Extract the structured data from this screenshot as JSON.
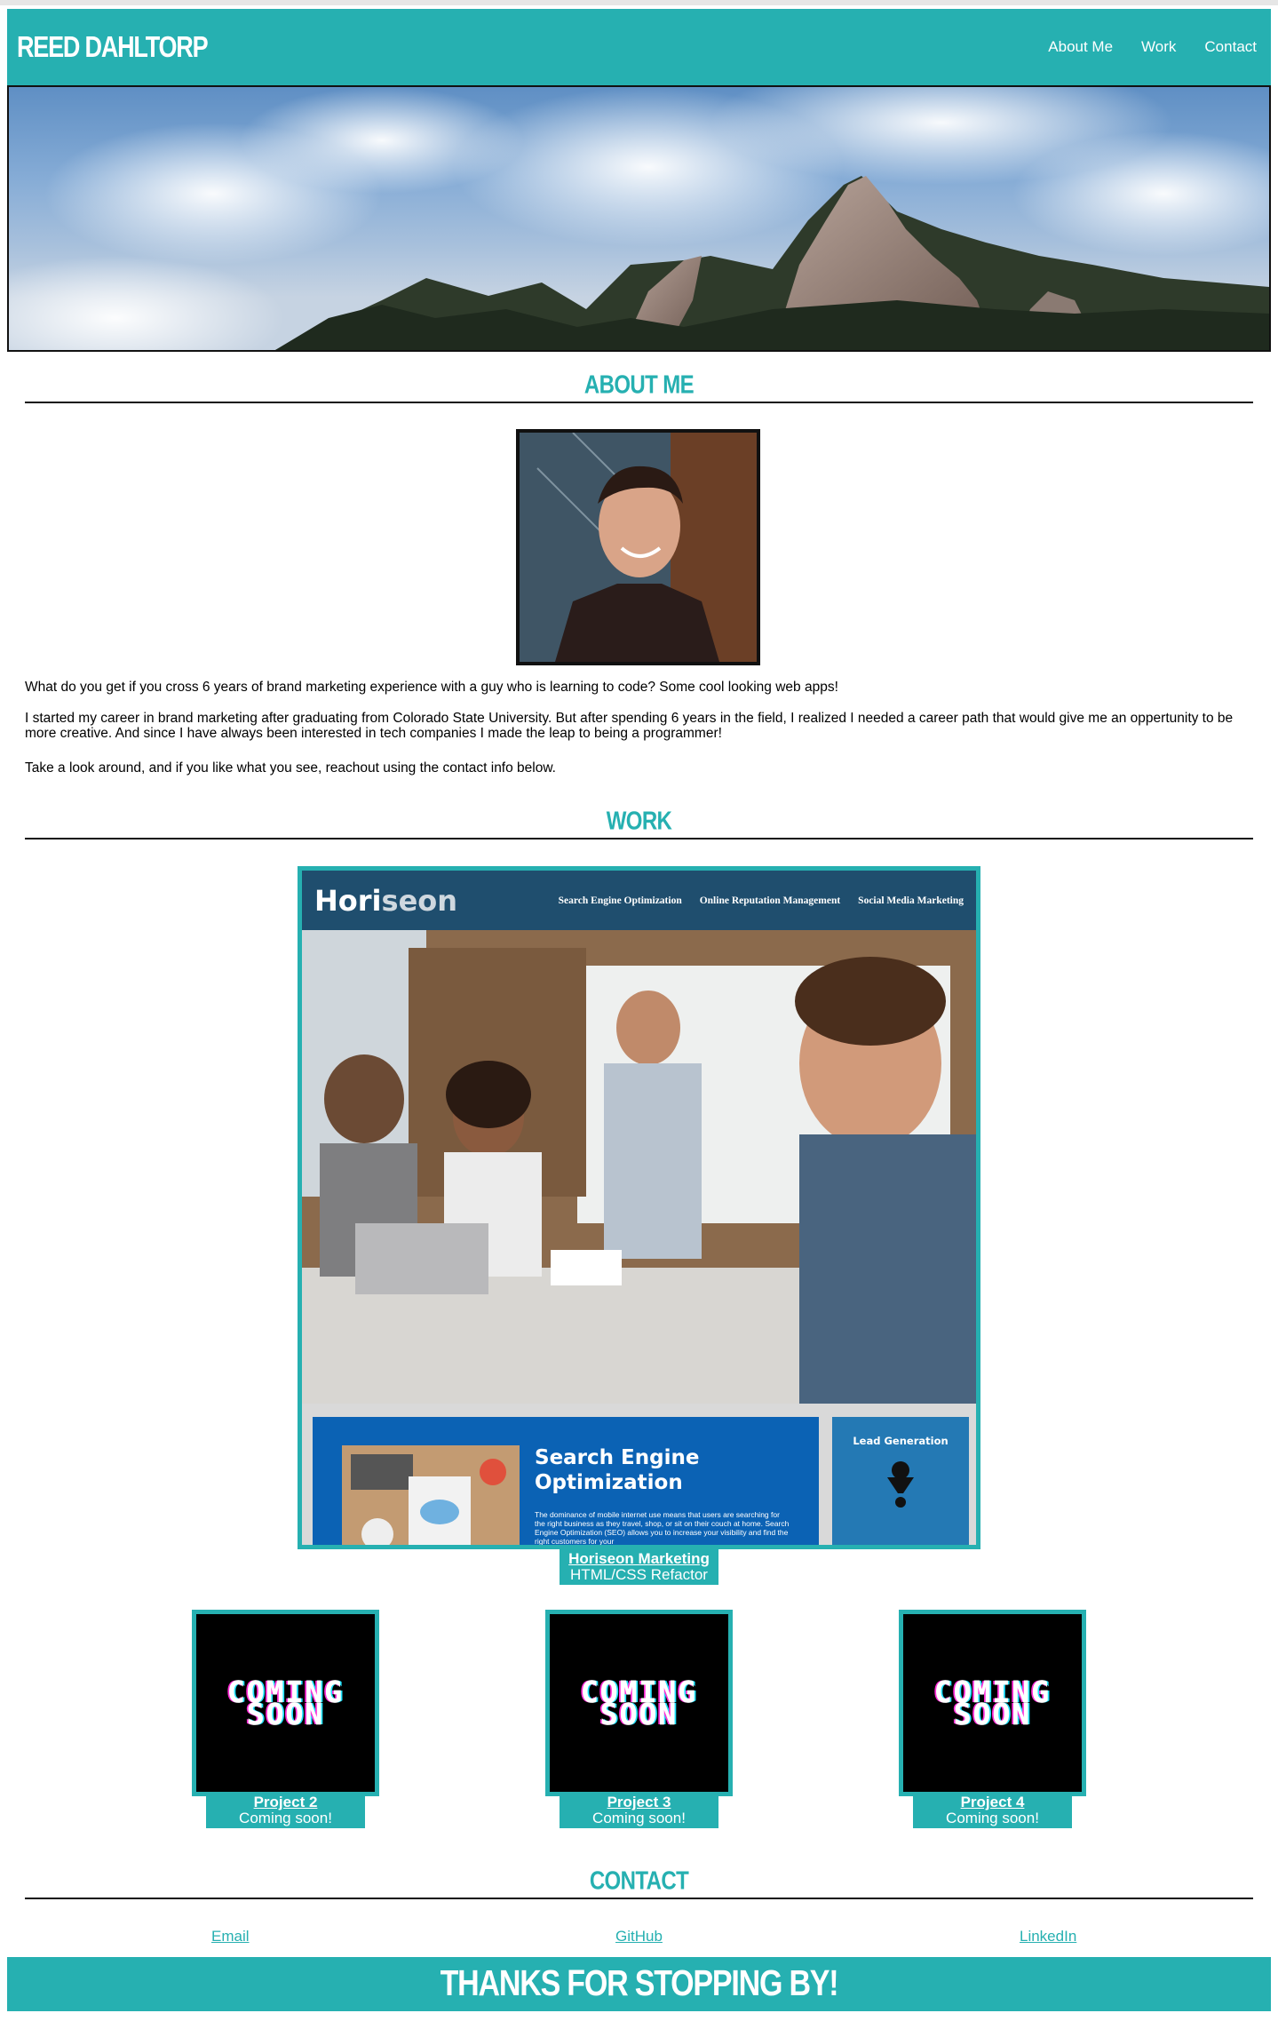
{
  "header": {
    "brand": "REED DAHLTORP",
    "nav": [
      {
        "label": "About Me"
      },
      {
        "label": "Work"
      },
      {
        "label": "Contact"
      }
    ]
  },
  "about": {
    "heading": "ABOUT ME",
    "paragraphs": [
      "What do you get if you cross 6 years of brand marketing experience with a guy who is learning to code? Some cool looking web apps!",
      "I started my career in brand marketing after graduating from Colorado State University. But after spending 6 years in the field, I realized I needed a career path that would give me an oppertunity to be more creative. And since I have always been interested in tech companies I made the leap to being a programmer!",
      "Take a look around, and if you like what you see, reachout using the contact info below."
    ]
  },
  "work": {
    "heading": "WORK",
    "featured": {
      "title": "Horiseon Marketing",
      "subtitle": "HTML/CSS Refactor",
      "screenshot": {
        "logo_main": "Hori",
        "logo_alt": "seon",
        "nav": [
          "Search Engine Optimization",
          "Online Reputation Management",
          "Social Media Marketing"
        ],
        "panel_title": "Search Engine Optimization",
        "panel_text": "The dominance of mobile internet use means that users are searching for the right business as they travel, shop, or sit on their couch at home. Search Engine Optimization (SEO) allows you to increase your visibility and find the right customers for your",
        "side_title": "Lead Generation"
      }
    },
    "projects": [
      {
        "title": "Project 2",
        "subtitle": "Coming soon!",
        "art_line1": "COMING",
        "art_line2": "SOON"
      },
      {
        "title": "Project 3",
        "subtitle": "Coming soon!",
        "art_line1": "COMING",
        "art_line2": "SOON"
      },
      {
        "title": "Project 4",
        "subtitle": "Coming soon!",
        "art_line1": "COMING",
        "art_line2": "SOON"
      }
    ]
  },
  "contact": {
    "heading": "CONTACT",
    "links": [
      {
        "label": "Email"
      },
      {
        "label": "GitHub"
      },
      {
        "label": "LinkedIn"
      }
    ]
  },
  "footer": {
    "text": "THANKS FOR STOPPING BY!"
  },
  "colors": {
    "accent": "#26b0b1",
    "rule": "#111111"
  }
}
